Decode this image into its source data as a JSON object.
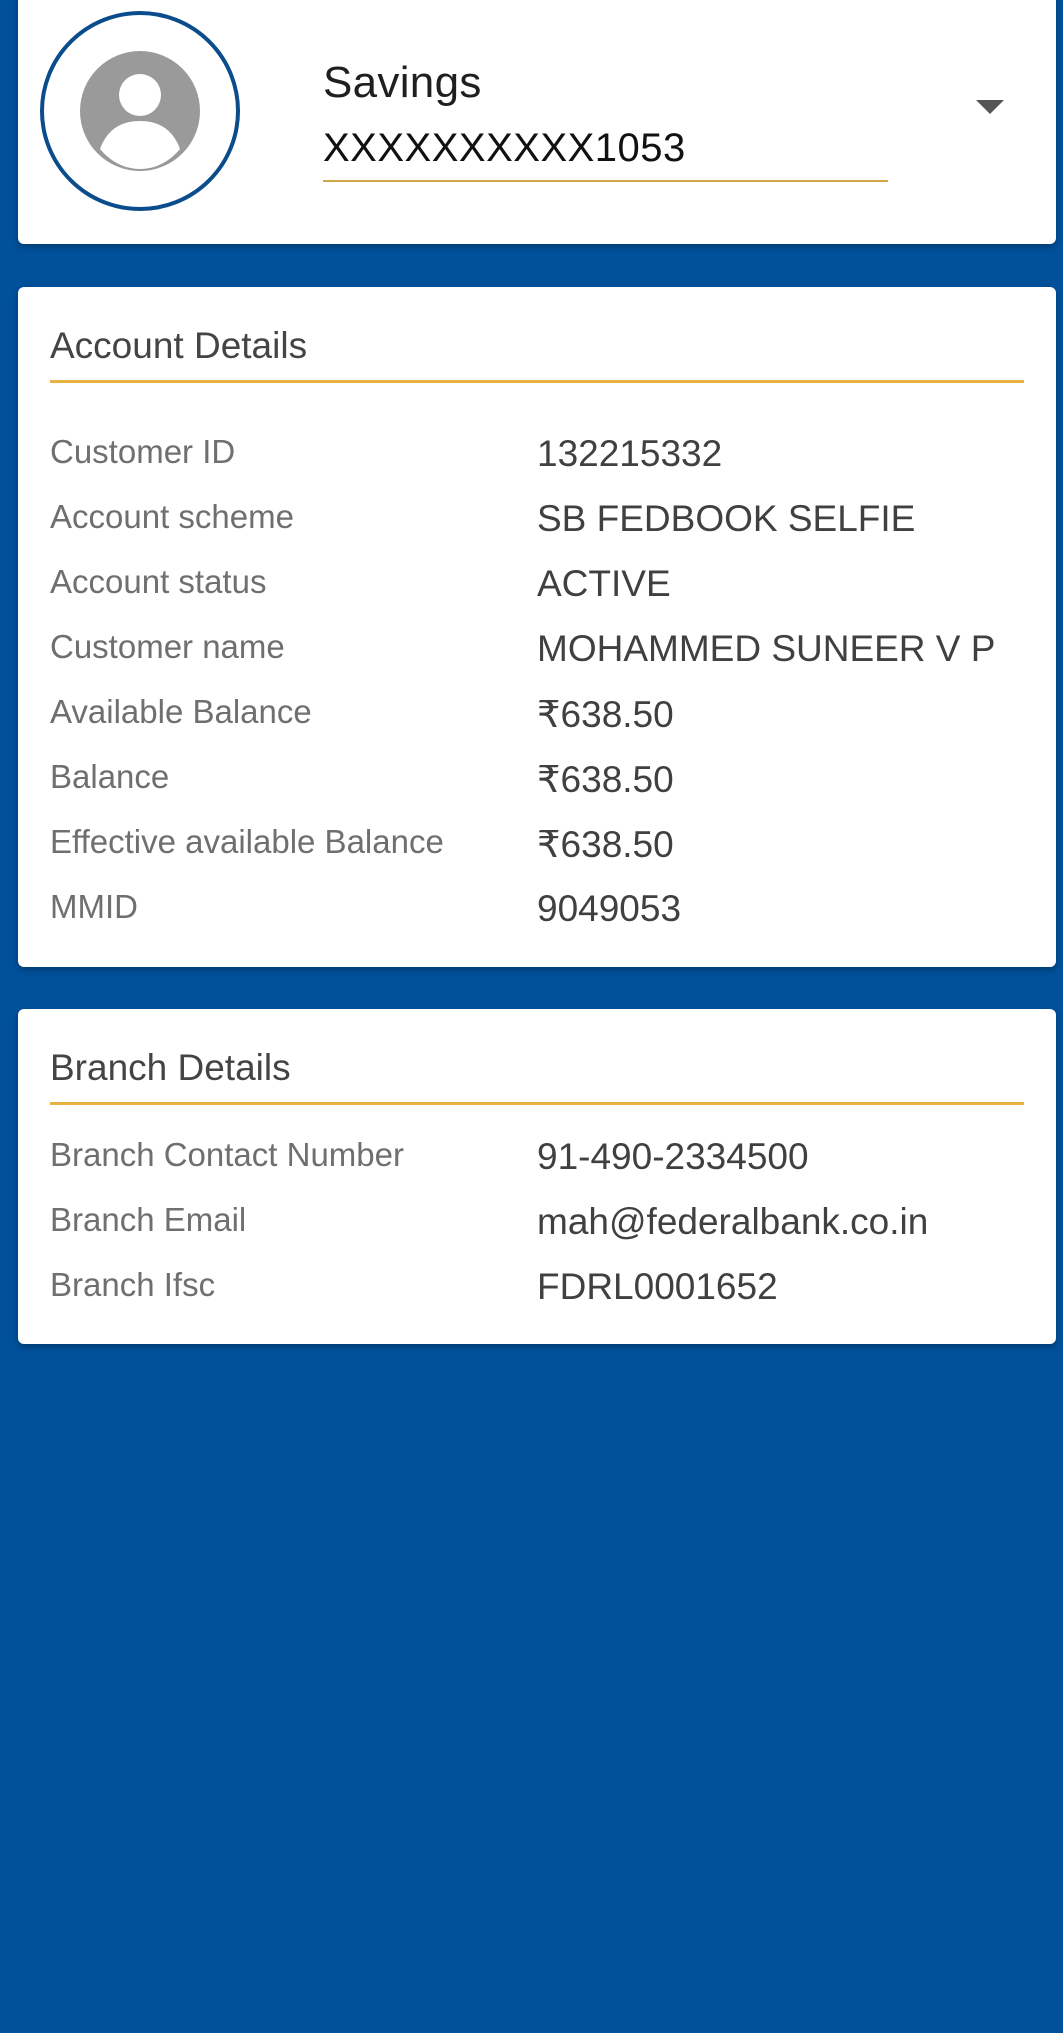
{
  "account_selector": {
    "avatar_icon": "user-avatar-icon",
    "account_type": "Savings",
    "account_number": "XXXXXXXXXX1053",
    "dropdown_icon": "caret-down-icon"
  },
  "account_details": {
    "title": "Account Details",
    "rows": [
      {
        "label": "Customer ID",
        "value": "132215332"
      },
      {
        "label": "Account scheme",
        "value": "SB FEDBOOK SELFIE"
      },
      {
        "label": "Account status",
        "value": "ACTIVE"
      },
      {
        "label": "Customer name",
        "value": "MOHAMMED SUNEER V P"
      },
      {
        "label": "Available Balance",
        "value": "₹638.50"
      },
      {
        "label": "Balance",
        "value": "₹638.50"
      },
      {
        "label": "Effective available Balance",
        "value": "₹638.50"
      },
      {
        "label": "MMID",
        "value": "9049053"
      }
    ]
  },
  "branch_details": {
    "title": "Branch Details",
    "rows": [
      {
        "label": "Branch Contact Number",
        "value": "91-490-2334500"
      },
      {
        "label": "Branch Email",
        "value": "mah@federalbank.co.in"
      },
      {
        "label": "Branch Ifsc",
        "value": "FDRL0001652"
      }
    ]
  },
  "colors": {
    "background": "#01509a",
    "card": "#ffffff",
    "accent_rule": "#eab341",
    "avatar_ring": "#0b4d8c"
  }
}
